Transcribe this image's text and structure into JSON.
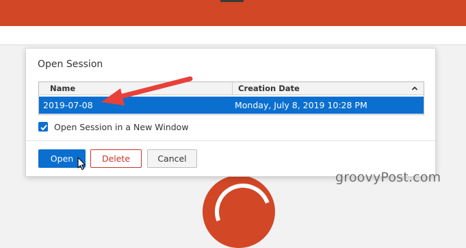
{
  "dialog": {
    "title": "Open Session",
    "table": {
      "columns": [
        "Name",
        "Creation Date"
      ],
      "rows": [
        {
          "name": "2019-07-08",
          "creation_date": "Monday, July 8, 2019 10:28 PM",
          "selected": true
        }
      ],
      "sort_icon": "chevron-up-icon"
    },
    "checkbox": {
      "label": "Open Session in a New Window",
      "checked": true
    },
    "buttons": {
      "open": "Open",
      "delete": "Delete",
      "cancel": "Cancel"
    }
  },
  "annotation": {
    "arrow_color": "#e8403a"
  },
  "watermark": "groovyPost.com",
  "colors": {
    "accent": "#0b6fd0",
    "brand_bar": "#d24726",
    "danger": "#c8332a"
  }
}
